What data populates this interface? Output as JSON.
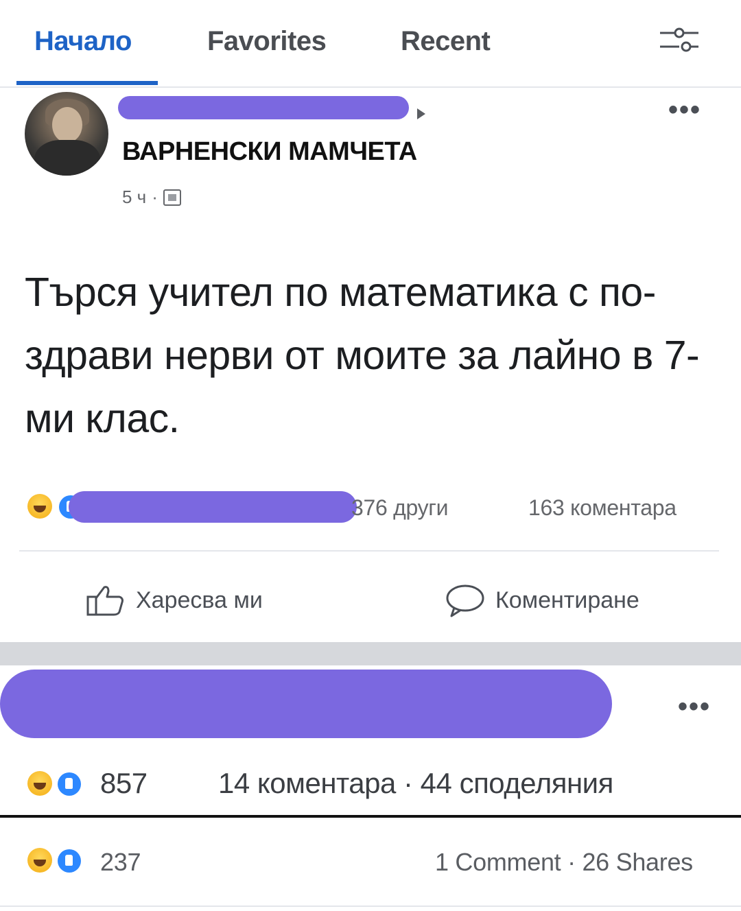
{
  "nav": {
    "tabs": [
      {
        "label": "Начало",
        "active": true
      },
      {
        "label": "Favorites",
        "active": false
      },
      {
        "label": "Recent",
        "active": false
      }
    ],
    "filter_icon": "sliders-icon"
  },
  "post": {
    "group_name": "ВАРНЕНСКИ МАМЧЕТА",
    "time": "5 ч",
    "meta_separator": "·",
    "more_label": "•••",
    "text": "Търся учител по математика с по-здрави нерви от моите за лайно в 7-ми клас.",
    "reactions": {
      "others_text": "376 други",
      "comments_text": "163 коментара"
    },
    "actions": {
      "like_label": "Харесва ми",
      "comment_label": "Коментиране"
    }
  },
  "second_post": {
    "more_label": "•••",
    "reaction_count": "857",
    "comments_shares_text": "14 коментара · 44 споделяния"
  },
  "third_post": {
    "reaction_count": "237",
    "comments_shares_text": "1 Comment · 26 Shares"
  },
  "colors": {
    "accent": "#1e63c6",
    "redaction": "#7b68e0",
    "like_blue": "#2d88ff",
    "haha_yellow": "#f7b928"
  }
}
